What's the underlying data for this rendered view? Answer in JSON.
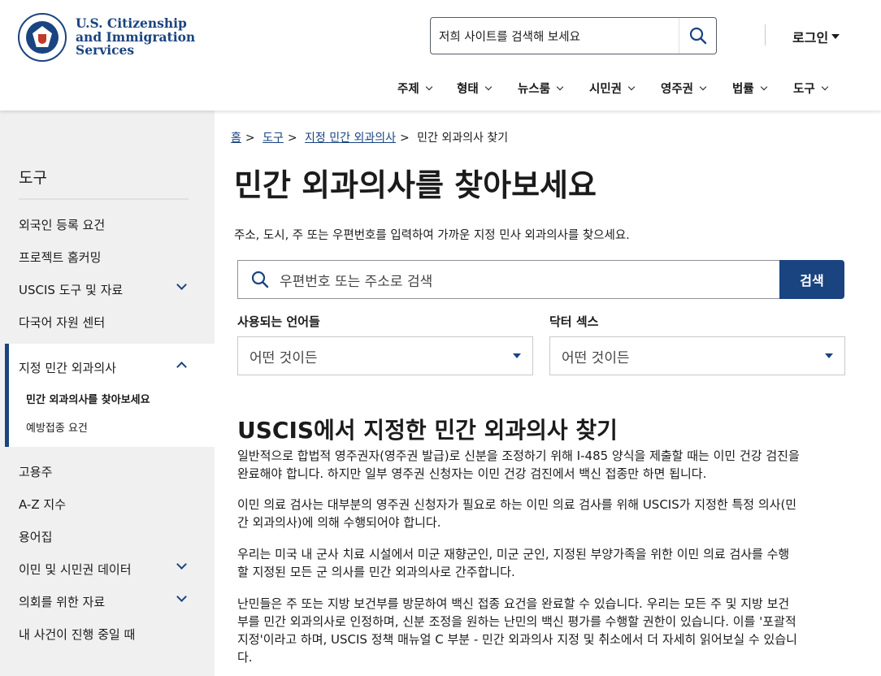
{
  "header": {
    "agency_lines": [
      "U.S. Citizenship",
      "and Immigration",
      "Services"
    ],
    "search_placeholder": "저희 사이트를 검색해 보세요",
    "login_label": "로그인",
    "nav": [
      "주제",
      "형태",
      "뉴스룸",
      "시민권",
      "영주권",
      "법률",
      "도구"
    ]
  },
  "sidebar": {
    "title": "도구",
    "items_top": [
      {
        "label": "외국인 등록 요건",
        "expandable": false
      },
      {
        "label": "프로젝트 홈커밍",
        "expandable": false
      },
      {
        "label": "USCIS 도구 및 자료",
        "expandable": true
      },
      {
        "label": "다국어 자원 센터",
        "expandable": false
      }
    ],
    "active": {
      "label": "지정 민간 외과의사",
      "children": [
        "민간 외과의사를 찾아보세요",
        "예방접종 요건"
      ]
    },
    "items_bottom": [
      {
        "label": "고용주",
        "expandable": false
      },
      {
        "label": "A-Z 지수",
        "expandable": false
      },
      {
        "label": "용어집",
        "expandable": false
      },
      {
        "label": "이민 및 시민권 데이터",
        "expandable": true
      },
      {
        "label": "의회를 위한 자료",
        "expandable": true
      },
      {
        "label": "내 사건이 진행 중일 때",
        "expandable": false
      }
    ]
  },
  "main": {
    "breadcrumb": [
      "홈",
      "도구",
      "지정 민간 외과의사",
      "민간 외과의사 찾기"
    ],
    "title": "민간 외과의사를 찾아보세요",
    "intro": "주소, 도시, 주 또는 우편번호를 입력하여 가까운 지정 민사 외과의사를 찾으세요.",
    "search_placeholder": "우편번호 또는 주소로 검색",
    "search_button": "검색",
    "filters": [
      {
        "label": "사용되는 언어들",
        "value": "어떤 것이든"
      },
      {
        "label": "닥터 섹스",
        "value": "어떤 것이든"
      }
    ],
    "section_title": "USCIS에서 지정한 민간 외과의사 찾기",
    "paragraphs": [
      [
        "일반적으로 합법적 영주권자(영주권 발급)로 신분을 조정하기 위해 I-485 양식을 제출할 때는 이민 건강 검진을",
        "완료해야 합니다. 하지만 일부 영주권 신청자는 이민 건강 검진에서 백신 접종만 하면 됩니다."
      ],
      [
        "이민 의료 검사는 대부분의 영주권 신청자가 필요로 하는 이민 의료 검사를 위해 USCIS가 지정한 특정 의사(민",
        "간 외과의사)에 의해 수행되어야 합니다."
      ],
      [
        "우리는 미국 내 군사 치료 시설에서 미군 재향군인, 미군 군인, 지정된 부양가족을 위한 이민 의료 검사를 수행",
        "할 지정된 모든 군 의사를 민간 외과의사로 간주합니다."
      ],
      [
        "난민들은 주 또는 지방 보건부를 방문하여 백신 접종 요건을 완료할 수 있습니다. 우리는 모든 주 및 지방 보건",
        "부를 민간 외과의사로 인정하며, 신분 조정을 원하는 난민의 백신 평가를 수행할 권한이 있습니다. 이를 '포괄적",
        "지정'이라고 하며, USCIS 정책 매뉴얼 C 부분 - 민간 외과의사 지정 및 취소에서 더 자세히 읽어보실 수 있습니",
        "다."
      ]
    ]
  },
  "colors": {
    "primary": "#1a4480",
    "sidebar_bg": "#f0f0f0"
  }
}
